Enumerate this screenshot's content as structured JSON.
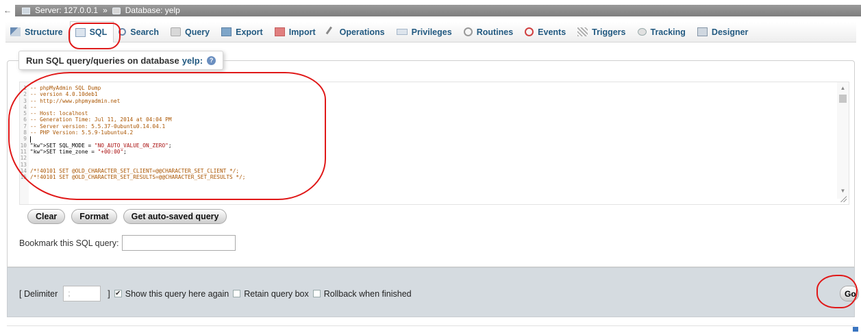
{
  "breadcrumb": {
    "server_label": "Server: 127.0.0.1",
    "separator": "»",
    "database_label": "Database: yelp"
  },
  "tabs": [
    {
      "label": "Structure",
      "icon": "structure-icon"
    },
    {
      "label": "SQL",
      "icon": "sql-icon",
      "active": true
    },
    {
      "label": "Search",
      "icon": "search-icon"
    },
    {
      "label": "Query",
      "icon": "query-icon"
    },
    {
      "label": "Export",
      "icon": "export-icon"
    },
    {
      "label": "Import",
      "icon": "import-icon"
    },
    {
      "label": "Operations",
      "icon": "operations-icon"
    },
    {
      "label": "Privileges",
      "icon": "privileges-icon"
    },
    {
      "label": "Routines",
      "icon": "routines-icon"
    },
    {
      "label": "Events",
      "icon": "events-icon"
    },
    {
      "label": "Triggers",
      "icon": "triggers-icon"
    },
    {
      "label": "Tracking",
      "icon": "tracking-icon"
    },
    {
      "label": "Designer",
      "icon": "designer-icon"
    }
  ],
  "legend": {
    "prefix": "Run SQL query/queries on database",
    "database": "yelp:"
  },
  "editor": {
    "lines": [
      {
        "n": "1",
        "text": "-- phpMyAdmin SQL Dump"
      },
      {
        "n": "2",
        "text": "-- version 4.0.10deb1"
      },
      {
        "n": "3",
        "text": "-- http://www.phpmyadmin.net"
      },
      {
        "n": "4",
        "text": "--"
      },
      {
        "n": "5",
        "text": "-- Host: localhost"
      },
      {
        "n": "6",
        "text": "-- Generation Time: Jul 11, 2014 at 04:04 PM"
      },
      {
        "n": "7",
        "text": "-- Server version: 5.5.37-0ubuntu0.14.04.1"
      },
      {
        "n": "8",
        "text": "-- PHP Version: 5.5.9-1ubuntu4.2"
      },
      {
        "n": "9",
        "text": ""
      },
      {
        "n": "10",
        "text": "SET SQL_MODE = \"NO_AUTO_VALUE_ON_ZERO\";"
      },
      {
        "n": "11",
        "text": "SET time_zone = \"+00:00\";"
      },
      {
        "n": "12",
        "text": ""
      },
      {
        "n": "13",
        "text": ""
      },
      {
        "n": "14",
        "text": "/*!40101 SET @OLD_CHARACTER_SET_CLIENT=@@CHARACTER_SET_CLIENT */;"
      },
      {
        "n": "15",
        "text": "/*!40101 SET @OLD_CHARACTER_SET_RESULTS=@@CHARACTER_SET_RESULTS */;"
      }
    ]
  },
  "buttons": {
    "clear": "Clear",
    "format": "Format",
    "autosaved": "Get auto-saved query"
  },
  "bookmark": {
    "label": "Bookmark this SQL query:",
    "value": ""
  },
  "options": {
    "delimiter_open": "[ Delimiter",
    "delimiter_value": ";",
    "delimiter_close": "]",
    "show_query_label": "Show this query here again",
    "show_query_checked": true,
    "retain_label": "Retain query box",
    "retain_checked": false,
    "rollback_label": "Rollback when finished",
    "rollback_checked": false
  },
  "go_label": "Go",
  "colors": {
    "annotation": "#e01818",
    "link": "#235a81",
    "panel": "#d5dbe0"
  }
}
